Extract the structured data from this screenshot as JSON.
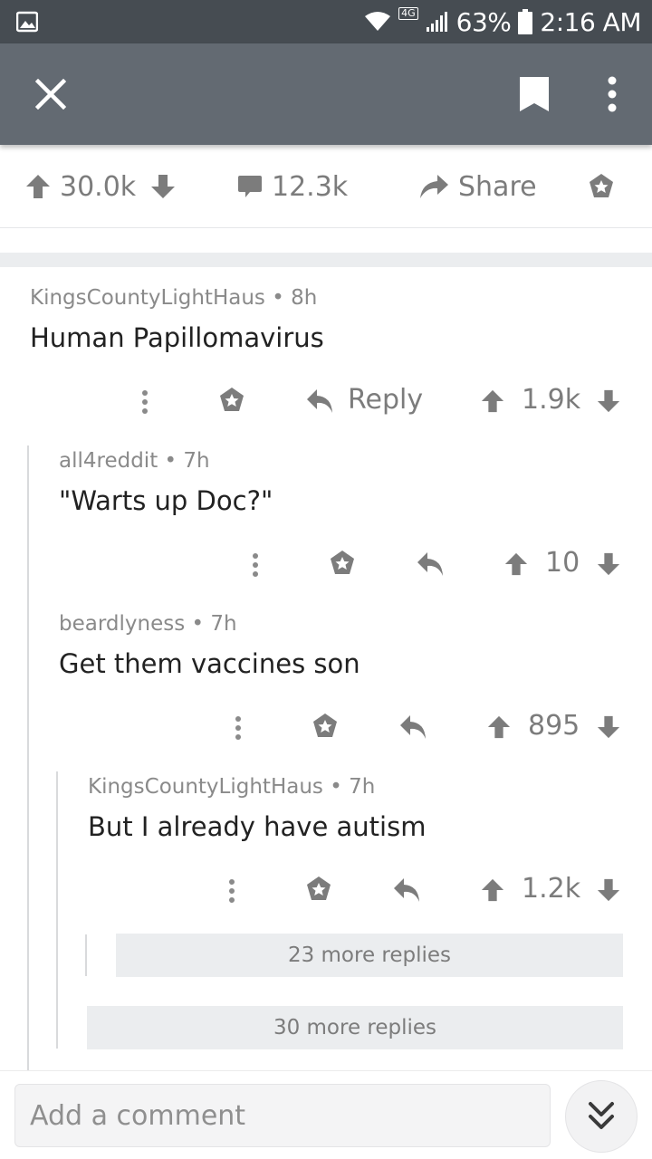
{
  "status_bar": {
    "battery": "63%",
    "time": "2:16 AM",
    "network": "4G"
  },
  "toolbar": {
    "icons": [
      "close-icon",
      "bookmark-icon",
      "more-vertical-icon"
    ]
  },
  "post_actions": {
    "score": "30.0k",
    "comments": "12.3k",
    "share_label": "Share"
  },
  "comments": [
    {
      "author": "KingsCountyLightHaus",
      "age": "8h",
      "body": "Human Papillomavirus",
      "reply_label": "Reply",
      "score": "1.9k",
      "depth": 0
    },
    {
      "author": "all4reddit",
      "age": "7h",
      "body": "\"Warts up Doc?\"",
      "score": "10",
      "depth": 1
    },
    {
      "author": "beardlyness",
      "age": "7h",
      "body": "Get them vaccines son",
      "score": "895",
      "depth": 1
    },
    {
      "author": "KingsCountyLightHaus",
      "age": "7h",
      "body": "But I already have autism",
      "score": "1.2k",
      "depth": 2
    }
  ],
  "more_replies": [
    {
      "label": "23 more replies"
    },
    {
      "label": "30 more replies"
    }
  ],
  "composer": {
    "placeholder": "Add a comment"
  },
  "colors": {
    "status_bar": "#464c52",
    "toolbar": "#636a72",
    "icon_gray": "#7c7c7c",
    "band": "#ebedef"
  }
}
